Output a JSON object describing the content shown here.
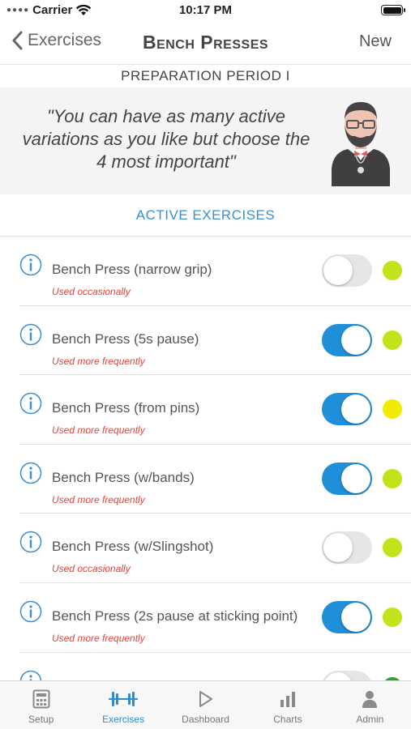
{
  "status_bar": {
    "carrier": "Carrier",
    "time": "10:17 PM",
    "battery_level": 1.0
  },
  "nav": {
    "back_label": "Exercises",
    "title": "Bench Presses",
    "right_label": "New"
  },
  "period_label": "PREPARATION PERIOD I",
  "quote": "\"You can have as many active variations as you like but choose the 4 most important\"",
  "section_header": "ACTIVE EXERCISES",
  "exercises": [
    {
      "name": "Bench Press (narrow grip)",
      "frequency": "Used occasionally",
      "active": false,
      "dot_color": "#c4e21a"
    },
    {
      "name": "Bench Press (5s pause)",
      "frequency": "Used more frequently",
      "active": true,
      "dot_color": "#c4e21a"
    },
    {
      "name": "Bench Press (from pins)",
      "frequency": "Used more frequently",
      "active": true,
      "dot_color": "#f2ea00"
    },
    {
      "name": "Bench Press (w/bands)",
      "frequency": "Used more frequently",
      "active": true,
      "dot_color": "#c4e21a"
    },
    {
      "name": "Bench Press (w/Slingshot)",
      "frequency": "Used occasionally",
      "active": false,
      "dot_color": "#c4e21a"
    },
    {
      "name": "Bench Press (2s pause at sticking point)",
      "frequency": "Used more frequently",
      "active": true,
      "dot_color": "#c4e21a"
    },
    {
      "name": "",
      "frequency": "",
      "active": false,
      "dot_color": "#2ca52c"
    }
  ],
  "tabs": [
    {
      "label": "Setup",
      "icon": "calculator-icon",
      "active": false
    },
    {
      "label": "Exercises",
      "icon": "barbell-icon",
      "active": true
    },
    {
      "label": "Dashboard",
      "icon": "play-icon",
      "active": false
    },
    {
      "label": "Charts",
      "icon": "bar-chart-icon",
      "active": false
    },
    {
      "label": "Admin",
      "icon": "person-icon",
      "active": false
    }
  ],
  "colors": {
    "accent": "#2e8bd6",
    "toggle_on": "#1f8fd9",
    "frequency_text": "#e8413a"
  }
}
